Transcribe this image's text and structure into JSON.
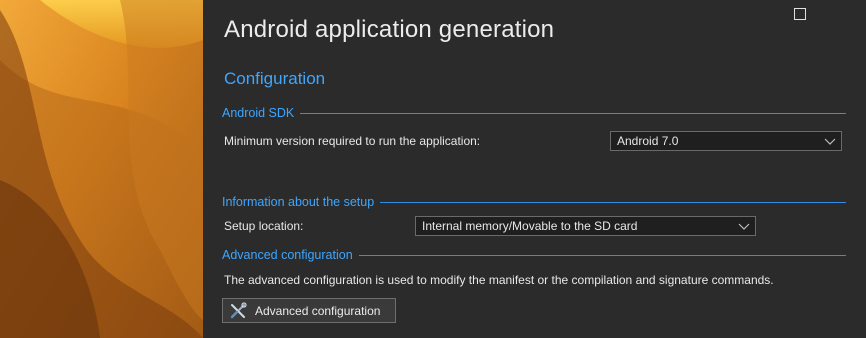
{
  "window": {
    "title": "Android application generation"
  },
  "page": {
    "section_title": "Configuration"
  },
  "android_sdk": {
    "group_label": "Android SDK",
    "min_version_label": "Minimum version required to run the application:",
    "min_version_value": "Android 7.0"
  },
  "setup": {
    "group_label": "Information about the setup",
    "location_label": "Setup location:",
    "location_value": "Internal memory/Movable to the SD card"
  },
  "advanced": {
    "group_label": "Advanced configuration",
    "description": "The advanced configuration is used to modify the manifest or the compilation and signature commands.",
    "button_label": "Advanced configuration"
  },
  "icons": {
    "maximize": "maximize-icon",
    "close": "close-icon",
    "dropdown": "chevron-down-icon",
    "tools": "tools-icon"
  },
  "colors": {
    "background": "#2b2b2b",
    "accent": "#3ea6ff",
    "rule": "#2e8fe6"
  }
}
